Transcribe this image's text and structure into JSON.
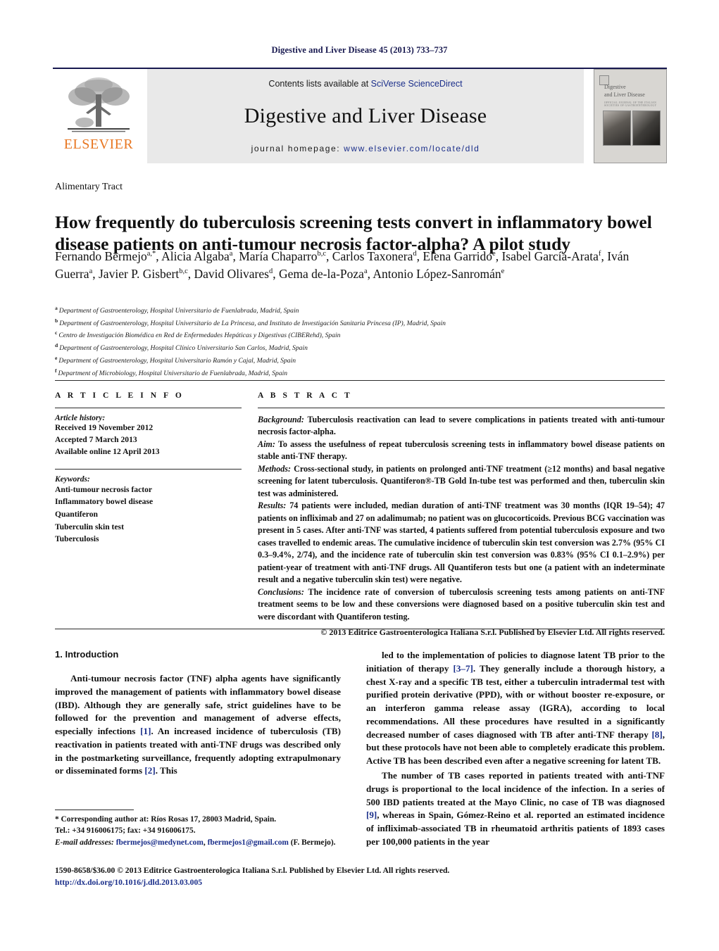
{
  "running_head": "Digestive and Liver Disease 45 (2013) 733–737",
  "masthead": {
    "publisher_logo_word": "ELSEVIER",
    "contents_prefix": "Contents lists available at ",
    "contents_link": "SciVerse ScienceDirect",
    "journal_title": "Digestive and Liver Disease",
    "homepage_prefix": "journal homepage: ",
    "homepage_url": "www.elsevier.com/locate/dld",
    "cover": {
      "title_line1": "Digestive",
      "title_line2": "and Liver Disease",
      "subtitle": "OFFICIAL JOURNAL OF THE ITALIAN SOCIETIES OF GASTROENTEROLOGY"
    }
  },
  "section_label": "Alimentary Tract",
  "title": "How frequently do tuberculosis screening tests convert in inflammatory bowel disease patients on anti-tumour necrosis factor-alpha? A pilot study",
  "authors_html": "Fernando Bermejo<sup>a,*</sup>, Alicia Algaba<sup>a</sup>, María Chaparro<sup>b,c</sup>, Carlos Taxonera<sup>d</sup>, Elena Garrido<sup>e</sup>, Isabel García-Arata<sup>f</sup>, Iván Guerra<sup>a</sup>, Javier P. Gisbert<sup>b,c</sup>, David Olivares<sup>d</sup>, Gema de-la-Poza<sup>a</sup>, Antonio López-Sanromán<sup>e</sup>",
  "affiliations": [
    {
      "label": "a",
      "text": "Department of Gastroenterology, Hospital Universitario de Fuenlabrada, Madrid, Spain"
    },
    {
      "label": "b",
      "text": "Department of Gastroenterology, Hospital Universitario de La Princesa, and Instituto de Investigación Sanitaria Princesa (IP), Madrid, Spain"
    },
    {
      "label": "c",
      "text": "Centro de Investigación Biomédica en Red de Enfermedades Hepáticas y Digestivas (CIBERehd), Spain"
    },
    {
      "label": "d",
      "text": "Department of Gastroenterology, Hospital Clínico Universitario San Carlos, Madrid, Spain"
    },
    {
      "label": "e",
      "text": "Department of Gastroenterology, Hospital Universitario Ramón y Cajal, Madrid, Spain"
    },
    {
      "label": "f",
      "text": "Department of Microbiology, Hospital Universitario de Fuenlabrada, Madrid, Spain"
    }
  ],
  "article_info": {
    "heading": "A R T I C L E   I N F O",
    "history_label": "Article history:",
    "history": [
      "Received 19 November 2012",
      "Accepted 7 March 2013",
      "Available online 12 April 2013"
    ],
    "keywords_label": "Keywords:",
    "keywords": [
      "Anti-tumour necrosis factor",
      "Inflammatory bowel disease",
      "Quantiferon",
      "Tuberculin skin test",
      "Tuberculosis"
    ]
  },
  "abstract": {
    "heading": "A B S T R A C T",
    "sections": [
      {
        "label": "Background:",
        "text": " Tuberculosis reactivation can lead to severe complications in patients treated with anti-tumour necrosis factor-alpha."
      },
      {
        "label": "Aim:",
        "text": " To assess the usefulness of repeat tuberculosis screening tests in inflammatory bowel disease patients on stable anti-TNF therapy."
      },
      {
        "label": "Methods:",
        "text": " Cross-sectional study, in patients on prolonged anti-TNF treatment (≥12 months) and basal negative screening for latent tuberculosis. Quantiferon®-TB Gold In-tube test was performed and then, tuberculin skin test was administered."
      },
      {
        "label": "Results:",
        "text": " 74 patients were included, median duration of anti-TNF treatment was 30 months (IQR 19–54); 47 patients on infliximab and 27 on adalimumab; no patient was on glucocorticoids. Previous BCG vaccination was present in 5 cases. After anti-TNF was started, 4 patients suffered from potential tuberculosis exposure and two cases travelled to endemic areas. The cumulative incidence of tuberculin skin test conversion was 2.7% (95% CI 0.3–9.4%, 2/74), and the incidence rate of tuberculin skin test conversion was 0.83% (95% CI 0.1–2.9%) per patient-year of treatment with anti-TNF drugs. All Quantiferon tests but one (a patient with an indeterminate result and a negative tuberculin skin test) were negative."
      },
      {
        "label": "Conclusions:",
        "text": " The incidence rate of conversion of tuberculosis screening tests among patients on anti-TNF treatment seems to be low and these conversions were diagnosed based on a positive tuberculin skin test and were discordant with Quantiferon testing."
      }
    ],
    "copyright": "© 2013 Editrice Gastroenterologica Italiana S.r.l. Published by Elsevier Ltd. All rights reserved."
  },
  "body": {
    "intro_heading": "1.  Introduction",
    "left_paragraphs": [
      "Anti-tumour necrosis factor (TNF) alpha agents have significantly improved the management of patients with inflammatory bowel disease (IBD). Although they are generally safe, strict guidelines have to be followed for the prevention and management of adverse effects, especially infections [1]. An increased incidence of tuberculosis (TB) reactivation in patients treated with anti-TNF drugs was described only in the postmarketing surveillance, frequently adopting extrapulmonary or disseminated forms [2]. This"
    ],
    "right_paragraphs": [
      "led to the implementation of policies to diagnose latent TB prior to the initiation of therapy [3–7]. They generally include a thorough history, a chest X-ray and a specific TB test, either a tuberculin intradermal test with purified protein derivative (PPD), with or without booster re-exposure, or an interferon gamma release assay (IGRA), according to local recommendations. All these procedures have resulted in a significantly decreased number of cases diagnosed with TB after anti-TNF therapy [8], but these protocols have not been able to completely eradicate this problem. Active TB has been described even after a negative screening for latent TB.",
      "The number of TB cases reported in patients treated with anti-TNF drugs is proportional to the local incidence of the infection. In a series of 500 IBD patients treated at the Mayo Clinic, no case of TB was diagnosed [9], whereas in Spain, Gómez-Reino et al. reported an estimated incidence of infliximab-associated TB in rheumatoid arthritis patients of 1893 cases per 100,000 patients in the year"
    ]
  },
  "footnote": {
    "corresponding": "* Corresponding author at: Ríos Rosas 17, 28003 Madrid, Spain.",
    "tel": "Tel.: +34 916006175; fax: +34 916006175.",
    "email_label": "E-mail addresses:",
    "email1": "fbermejos@medynet.com",
    "email2": "fbermejos1@gmail.com",
    "email_owner": " (F. Bermejo)."
  },
  "bottom": {
    "issn_line": "1590-8658/$36.00 © 2013 Editrice Gastroenterologica Italiana S.r.l. Published by Elsevier Ltd. All rights reserved.",
    "doi": "http://dx.doi.org/10.1016/j.dld.2013.03.005"
  },
  "colors": {
    "link": "#1a2e8a",
    "elsevier_orange": "#e87722",
    "band_gray": "#e9e9e9"
  }
}
